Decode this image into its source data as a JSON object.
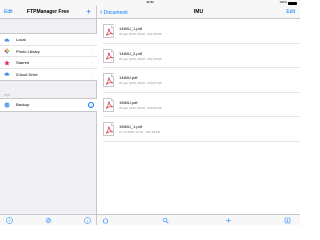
{
  "status_bar": {
    "time": "14:11",
    "battery": "100%"
  },
  "sidebar": {
    "title": "FTPManager Free",
    "edit_label": "Edit",
    "add_label": "+",
    "locations": [
      {
        "label": "Local",
        "icon": "cloud-icon",
        "color": "#4a90e2"
      },
      {
        "label": "Photo Library",
        "icon": "flower-icon",
        "color": "#e8a23a"
      },
      {
        "label": "Starred",
        "icon": "star-icon",
        "color": "#e0245e"
      },
      {
        "label": "iCloud Drive",
        "icon": "cloud-icon",
        "color": "#3a8ee6"
      }
    ],
    "section_label": "FTP",
    "servers": [
      {
        "label": "Backup",
        "icon": "globe-icon"
      }
    ]
  },
  "main": {
    "back_label": "Documenti",
    "title": "IMU",
    "edit_label": "Edit",
    "files": [
      {
        "name": "14IMU_1.pdf",
        "meta": "20 gen 2015, 00:00 - 252,18 KB"
      },
      {
        "name": "14IMU_2.pdf",
        "meta": "20 gen 2015, 00:00 - 252,18 KB"
      },
      {
        "name": "14IMU.pdf",
        "meta": "20 gen 2015, 00:00 - 230,07 KB"
      },
      {
        "name": "15IMU.pdf",
        "meta": "20 gen 2015, 00:00 - 253,20 KB"
      },
      {
        "name": "15IMU_1.pdf",
        "meta": "07 ott 2015, 12:01 - 252,18 KB"
      }
    ]
  },
  "colors": {
    "accent": "#007aff",
    "pdf_red": "#d0021b"
  }
}
